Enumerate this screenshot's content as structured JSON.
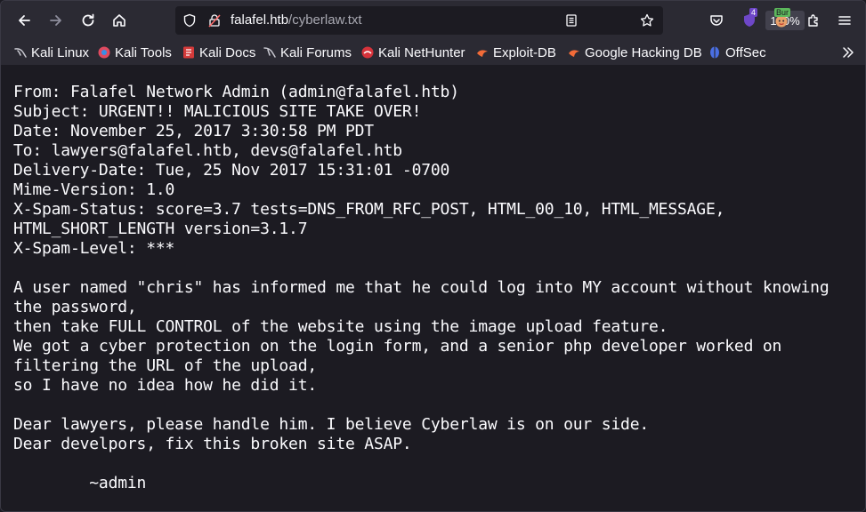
{
  "browser": {
    "url_host": "falafel.htb",
    "url_path": "/cyberlaw.txt",
    "zoom": "150%",
    "ublock_count": "4",
    "burp_badge": "Bur"
  },
  "bookmarks": [
    {
      "label": "Kali Linux",
      "icon": "kali-dragon-icon"
    },
    {
      "label": "Kali Tools",
      "icon": "kali-tools-icon"
    },
    {
      "label": "Kali Docs",
      "icon": "kali-docs-icon"
    },
    {
      "label": "Kali Forums",
      "icon": "kali-forums-icon"
    },
    {
      "label": "Kali NetHunter",
      "icon": "nethunter-icon"
    },
    {
      "label": "Exploit-DB",
      "icon": "exploit-db-icon"
    },
    {
      "label": "Google Hacking DB",
      "icon": "ghdb-icon"
    },
    {
      "label": "OffSec",
      "icon": "offsec-icon"
    }
  ],
  "document": {
    "text": "From: Falafel Network Admin (admin@falafel.htb)\nSubject: URGENT!! MALICIOUS SITE TAKE OVER!\nDate: November 25, 2017 3:30:58 PM PDT\nTo: lawyers@falafel.htb, devs@falafel.htb\nDelivery-Date: Tue, 25 Nov 2017 15:31:01 -0700\nMime-Version: 1.0\nX-Spam-Status: score=3.7 tests=DNS_FROM_RFC_POST, HTML_00_10, HTML_MESSAGE,\nHTML_SHORT_LENGTH version=3.1.7\nX-Spam-Level: ***\n\nA user named \"chris\" has informed me that he could log into MY account without knowing\nthe password,\nthen take FULL CONTROL of the website using the image upload feature.\nWe got a cyber protection on the login form, and a senior php developer worked on\nfiltering the URL of the upload,\nso I have no idea how he did it.\n\nDear lawyers, please handle him. I believe Cyberlaw is on our side.\nDear develpors, fix this broken site ASAP.\n\n        ~admin"
  }
}
